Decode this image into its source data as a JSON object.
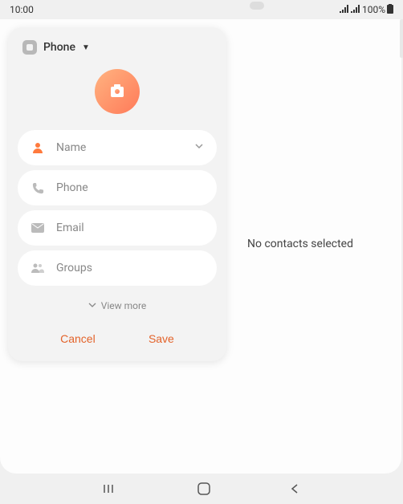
{
  "statusbar": {
    "time": "10:00",
    "battery": "100%"
  },
  "main": {
    "empty_text": "No contacts selected"
  },
  "panel": {
    "account_label": "Phone",
    "fields": {
      "name": "Name",
      "phone": "Phone",
      "email": "Email",
      "groups": "Groups"
    },
    "view_more": "View more",
    "cancel": "Cancel",
    "save": "Save"
  }
}
